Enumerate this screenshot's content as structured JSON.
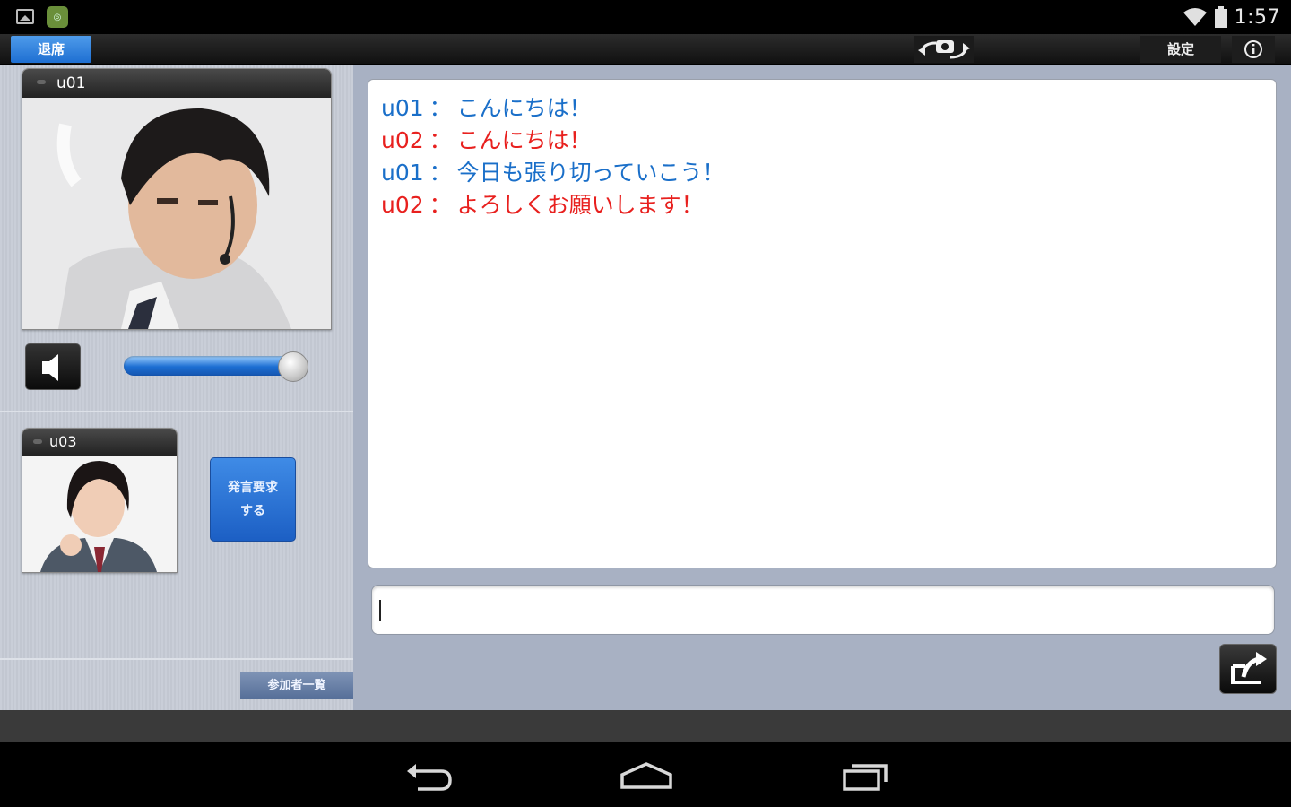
{
  "status_bar": {
    "time": "1:57",
    "left_icons": [
      "picture-icon",
      "app-notification-icon"
    ],
    "right_icons": [
      "wifi-icon",
      "battery-icon"
    ]
  },
  "action_bar": {
    "leave_label": "退席",
    "settings_label": "設定",
    "camera_switch_icon": "camera-rotate-icon",
    "info_icon": "info-icon"
  },
  "left_panel": {
    "main_video": {
      "user": "u01"
    },
    "volume": {
      "level_fraction": 0.92
    },
    "small_video": {
      "user": "u03"
    },
    "request_button_label": "発言要求\nする",
    "participants_button_label": "参加者一覧"
  },
  "chat": {
    "separator": "：",
    "messages": [
      {
        "user": "u01",
        "text": "こんにちは！",
        "color": "#1a6fc9"
      },
      {
        "user": "u02",
        "text": "こんにちは！",
        "color": "#e8201e"
      },
      {
        "user": "u01",
        "text": "今日も張り切っていこう！",
        "color": "#1a6fc9"
      },
      {
        "user": "u02",
        "text": "よろしくお願いします！",
        "color": "#e8201e"
      }
    ],
    "input_value": ""
  },
  "nav": {
    "icons": [
      "back-icon",
      "home-icon",
      "recent-apps-icon"
    ]
  }
}
